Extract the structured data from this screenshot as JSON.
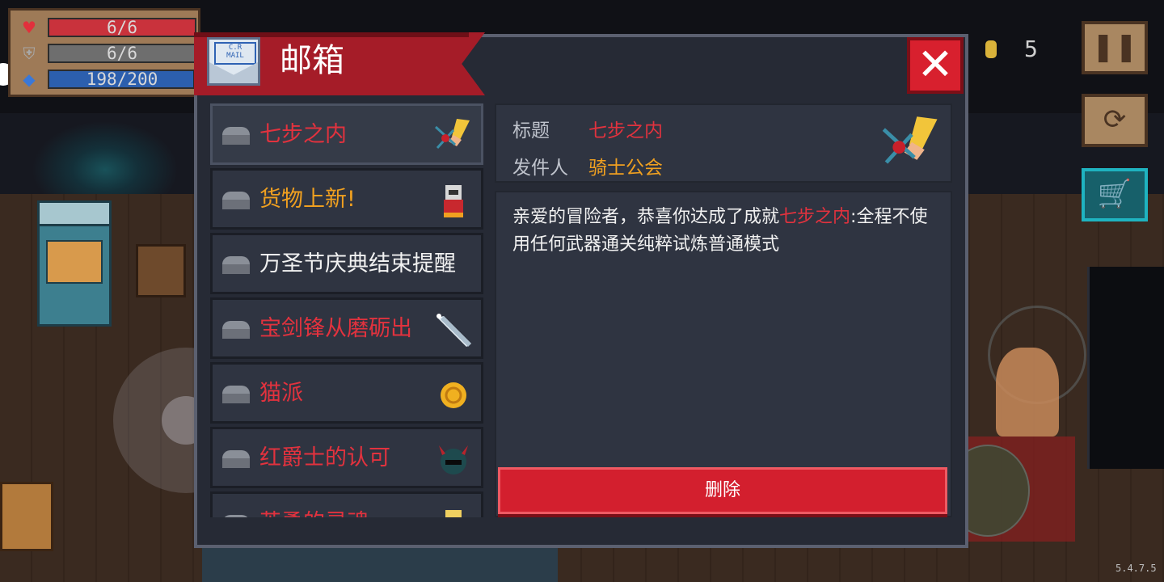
{
  "hud": {
    "health": "6/6",
    "armor": "6/6",
    "energy": "198/200",
    "health_fill": 1.0,
    "armor_fill": 1.0,
    "energy_fill": 0.99
  },
  "top_right": {
    "coins": "5"
  },
  "version": "5.4.7.5",
  "mailbox": {
    "title": "邮箱",
    "mail_icon_label": "C.R\nMAIL",
    "close_symbol": "✕",
    "items": [
      {
        "title": "七步之内",
        "color": "#e2323e",
        "icon": "sword-hand-icon"
      },
      {
        "title": "货物上新!",
        "color": "#f0a020",
        "icon": "merchant-icon"
      },
      {
        "title": "万圣节庆典结束提醒",
        "color": "#f1f1f1",
        "icon": ""
      },
      {
        "title": "宝剑锋从磨砺出",
        "color": "#e2323e",
        "icon": "sword-icon"
      },
      {
        "title": "猫派",
        "color": "#e2323e",
        "icon": "gold-coin-icon"
      },
      {
        "title": "红爵士的认可",
        "color": "#e2323e",
        "icon": "knight-helmet-icon"
      },
      {
        "title": "英勇的灵魂",
        "color": "#e2323e",
        "icon": "soul-icon"
      }
    ],
    "detail": {
      "title_label": "标题",
      "title_value": "七步之内",
      "sender_label": "发件人",
      "sender_value": "骑士公会",
      "body_prefix": "亲爱的冒险者，恭喜你达成了成就",
      "body_highlight": "七步之内",
      "body_suffix": ":全程不使用任何武器通关纯粹试炼普通模式",
      "delete_label": "删除"
    }
  },
  "colors": {
    "accent_red": "#d31f2e",
    "title_banner": "#a51c28",
    "highlight_red": "#e2323e",
    "highlight_orange": "#f0a020",
    "panel_bg": "#262a35"
  }
}
